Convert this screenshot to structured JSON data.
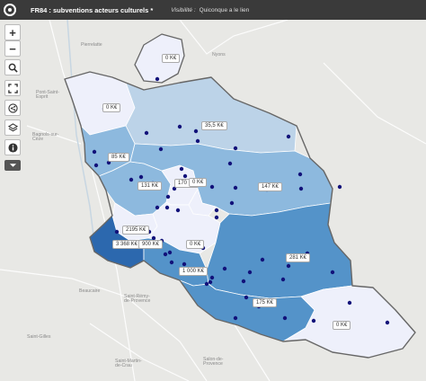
{
  "app": {
    "title": "FR84 : subventions acteurs culturels *",
    "visibility_label": "Visibilité :",
    "visibility_value": "Quiconque a le lien"
  },
  "controls": {
    "zoom_in": "+",
    "zoom_out": "−",
    "search_icon": "search-icon",
    "fullscreen_icon": "fullscreen-icon",
    "share_icon": "share-icon",
    "layers_icon": "layers-icon",
    "info_icon": "info-icon",
    "dropdown_icon": "chevron-down-icon"
  },
  "colors": {
    "topbar": "#3a3a3a",
    "fill_0": "#eef0fb",
    "fill_low": "#bcd3e8",
    "fill_mid": "#8db9de",
    "fill_high": "#5493c9",
    "fill_max": "#2c68ae",
    "point": "#12127a"
  },
  "value_labels": [
    {
      "id": "nyons",
      "text": "0 K€"
    },
    {
      "id": "valreas",
      "text": "0 K€"
    },
    {
      "id": "vaison",
      "text": "35,5 K€"
    },
    {
      "id": "bollene",
      "text": "85 K€"
    },
    {
      "id": "orange",
      "text": "131 K€"
    },
    {
      "id": "carpentras-w",
      "text": "170 K€"
    },
    {
      "id": "carpentras-e",
      "text": "0 K€"
    },
    {
      "id": "mormoiron",
      "text": "147 K€"
    },
    {
      "id": "sorgues",
      "text": "2195 K€"
    },
    {
      "id": "avignon-a",
      "text": "3 368 K€"
    },
    {
      "id": "avignon-b",
      "text": "900 K€"
    },
    {
      "id": "isle",
      "text": "0 K€"
    },
    {
      "id": "cavaillon",
      "text": "1 000 K€"
    },
    {
      "id": "apt",
      "text": "281 K€"
    },
    {
      "id": "pertuis-w",
      "text": "175 K€"
    },
    {
      "id": "pertuis-e",
      "text": "0 K€"
    }
  ],
  "places": [
    {
      "id": "pierrelatte",
      "text": "Pierrelatte"
    },
    {
      "id": "nyons",
      "text": "Nyons"
    },
    {
      "id": "pont-saint-esprit",
      "text": "Pont-Saint-\nEsprit"
    },
    {
      "id": "bagnols",
      "text": "Bagnols-sur-\nCèze"
    },
    {
      "id": "beaucaire",
      "text": "Beaucaire"
    },
    {
      "id": "saint-remy",
      "text": "Saint-Rémy-\nde-Provence"
    },
    {
      "id": "saint-gilles",
      "text": "Saint-Gilles"
    },
    {
      "id": "saint-martin",
      "text": "Saint-Martin-\nde-Crau"
    },
    {
      "id": "salon",
      "text": "Salon-de-\nProvence"
    }
  ]
}
